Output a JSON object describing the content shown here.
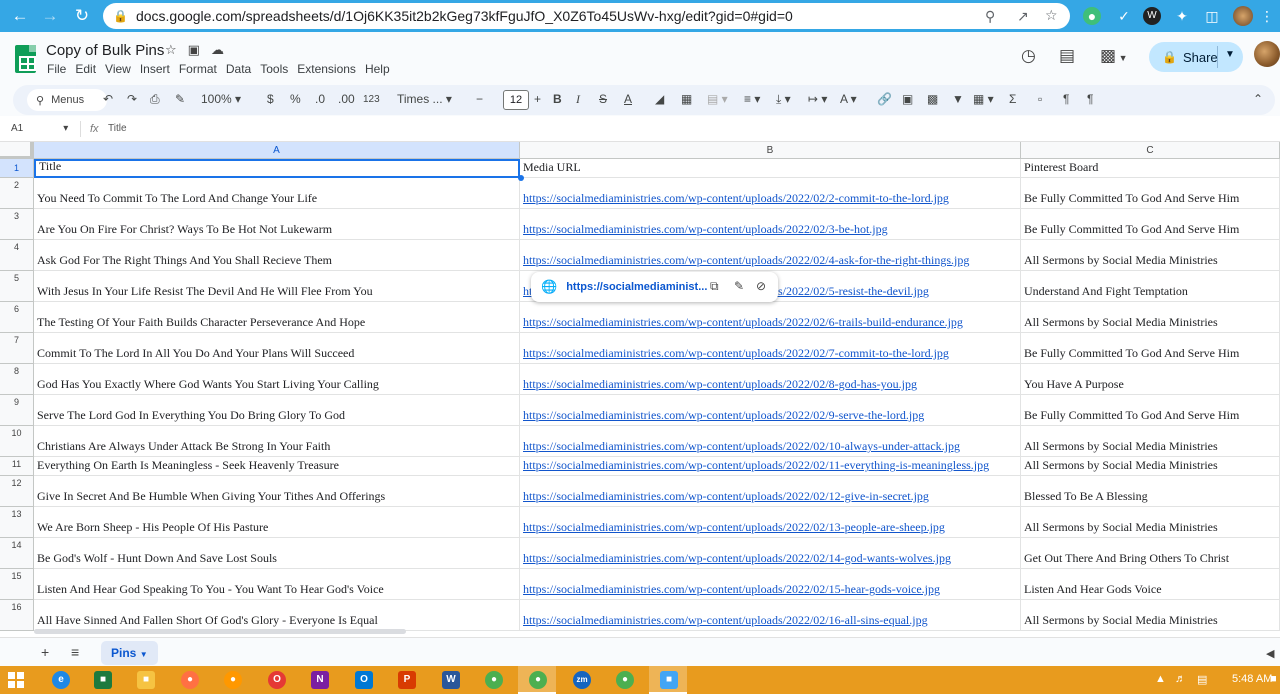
{
  "browser": {
    "url": "docs.google.com/spreadsheets/d/1Oj6KK35it2b2kGeg73kfFguJfO_X0Z6To45UsWv-hxg/edit?gid=0#gid=0"
  },
  "doc": {
    "title": "Copy of Bulk Pins",
    "menu": [
      "File",
      "Edit",
      "View",
      "Insert",
      "Format",
      "Data",
      "Tools",
      "Extensions",
      "Help"
    ],
    "share_label": "Share"
  },
  "toolbar": {
    "menus_label": "Menus",
    "zoom": "100%",
    "currency": "$",
    "percent": "%",
    "dec_less": ".0",
    "dec_more": ".00",
    "number_format": "123",
    "font": "Times ...",
    "font_size": "12",
    "minus": "−",
    "plus": "+",
    "bold": "B",
    "italic": "I",
    "strike": "S",
    "textcolor": "A",
    "sigma": "Σ"
  },
  "formula_bar": {
    "cell_ref": "A1",
    "fx": "fx",
    "content": "Title"
  },
  "grid": {
    "columns": [
      "A",
      "B",
      "C"
    ],
    "rows": [
      {
        "n": "1",
        "a": "Title",
        "b": "Media URL",
        "c": "Pinterest Board",
        "link": false
      },
      {
        "n": "2",
        "a": "You Need To Commit To The Lord And Change Your Life",
        "b": "https://socialmediaministries.com/wp-content/uploads/2022/02/2-commit-to-the-lord.jpg",
        "c": "Be Fully Committed To God And Serve Him",
        "link": true
      },
      {
        "n": "3",
        "a": "Are You On Fire For Christ? Ways To Be Hot Not Lukewarm",
        "b": "https://socialmediaministries.com/wp-content/uploads/2022/02/3-be-hot.jpg",
        "c": "Be Fully Committed To God And Serve Him",
        "link": true
      },
      {
        "n": "4",
        "a": "Ask God For The Right Things And You Shall Recieve Them",
        "b": "https://socialmediaministries.com/wp-content/uploads/2022/02/4-ask-for-the-right-things.jpg",
        "c": "All Sermons by Social Media Ministries",
        "link": true
      },
      {
        "n": "5",
        "a": "With Jesus In Your Life Resist The Devil And He Will Flee From You",
        "b": "https://socialmediaministries.com/wp-content/uploads/2022/02/5-resist-the-devil.jpg",
        "c": "Understand And Fight Temptation",
        "link": true
      },
      {
        "n": "6",
        "a": "The Testing Of Your Faith Builds Character Perseverance And Hope",
        "b": "https://socialmediaministries.com/wp-content/uploads/2022/02/6-trails-build-endurance.jpg",
        "c": "All Sermons by Social Media Ministries",
        "link": true
      },
      {
        "n": "7",
        "a": "Commit To The Lord In All You Do And Your Plans Will Succeed",
        "b": "https://socialmediaministries.com/wp-content/uploads/2022/02/7-commit-to-the-lord.jpg",
        "c": "Be Fully Committed To God And Serve Him",
        "link": true
      },
      {
        "n": "8",
        "a": "God Has You Exactly Where God Wants You Start Living Your Calling",
        "b": "https://socialmediaministries.com/wp-content/uploads/2022/02/8-god-has-you.jpg",
        "c": "You Have A Purpose",
        "link": true
      },
      {
        "n": "9",
        "a": "Serve The Lord God In Everything You Do Bring Glory To God",
        "b": "https://socialmediaministries.com/wp-content/uploads/2022/02/9-serve-the-lord.jpg",
        "c": "Be Fully Committed To God And Serve Him",
        "link": true
      },
      {
        "n": "10",
        "a": "Christians Are Always Under Attack Be Strong In Your Faith",
        "b": "https://socialmediaministries.com/wp-content/uploads/2022/02/10-always-under-attack.jpg",
        "c": "All Sermons by Social Media Ministries",
        "link": true
      },
      {
        "n": "11",
        "a": "Everything On Earth Is Meaningless - Seek Heavenly Treasure",
        "b": "https://socialmediaministries.com/wp-content/uploads/2022/02/11-everything-is-meaningless.jpg",
        "c": "All Sermons by Social Media Ministries",
        "link": true
      },
      {
        "n": "12",
        "a": "Give In Secret And Be Humble When Giving Your Tithes And Offerings",
        "b": "https://socialmediaministries.com/wp-content/uploads/2022/02/12-give-in-secret.jpg",
        "c": "Blessed To Be A Blessing",
        "link": true
      },
      {
        "n": "13",
        "a": "We Are Born Sheep - His People Of His Pasture",
        "b": "https://socialmediaministries.com/wp-content/uploads/2022/02/13-people-are-sheep.jpg",
        "c": "All Sermons by Social Media Ministries",
        "link": true
      },
      {
        "n": "14",
        "a": "Be God's Wolf - Hunt Down And Save Lost Souls",
        "b": "https://socialmediaministries.com/wp-content/uploads/2022/02/14-god-wants-wolves.jpg",
        "c": "Get Out There And Bring Others To Christ",
        "link": true
      },
      {
        "n": "15",
        "a": "Listen And Hear God Speaking To You - You Want To Hear God's Voice",
        "b": "https://socialmediaministries.com/wp-content/uploads/2022/02/15-hear-gods-voice.jpg",
        "c": "Listen And Hear Gods Voice",
        "link": true
      },
      {
        "n": "16",
        "a": "All Have Sinned And Fallen Short Of God's Glory - Everyone Is Equal",
        "b": "https://socialmediaministries.com/wp-content/uploads/2022/02/16-all-sins-equal.jpg",
        "c": "All Sermons by Social Media Ministries",
        "link": true
      }
    ]
  },
  "link_popup": {
    "url": "https://socialmediaminist..."
  },
  "sheet_tab": {
    "label": "Pins"
  },
  "taskbar": {
    "clock": "5:48 AM"
  },
  "colors": {
    "chrome": "#35a7e5",
    "taskbar": "#e89b1e",
    "link": "#1155cc",
    "selection": "#1a73e8"
  }
}
